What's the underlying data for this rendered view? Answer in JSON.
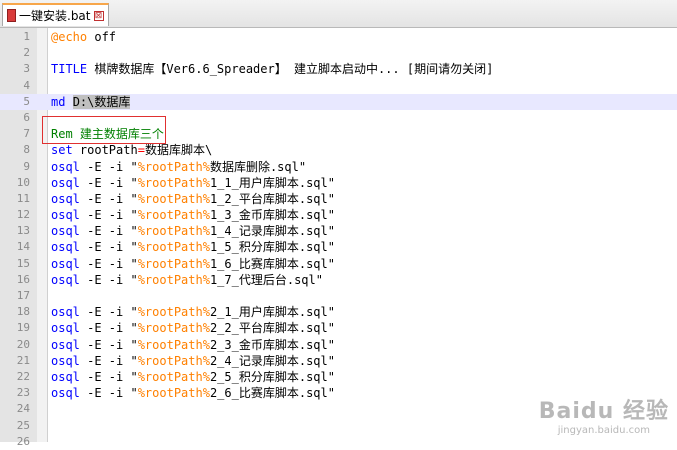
{
  "tab": {
    "title": "一键安装.bat",
    "close_glyph": "⊠"
  },
  "lines": [
    [
      {
        "t": "@echo",
        "c": "d"
      },
      {
        "t": " off",
        "c": "t"
      }
    ],
    [],
    [
      {
        "t": "TITLE",
        "c": "k"
      },
      {
        "t": " 棋牌数据库【Ver6.6_Spreader】 建立脚本启动中... ",
        "c": "t"
      },
      {
        "t": "[",
        "c": "t"
      },
      {
        "t": "期间请勿关闭",
        "c": "t"
      },
      {
        "t": "]",
        "c": "t"
      }
    ],
    [],
    [
      {
        "t": "md",
        "c": "k"
      },
      {
        "t": " ",
        "c": "t"
      },
      {
        "t": "D:\\数据库",
        "c": "sel"
      }
    ],
    [],
    [
      {
        "t": "Rem 建主数据库三个",
        "c": "c"
      }
    ],
    [
      {
        "t": "set",
        "c": "k"
      },
      {
        "t": " rootPath",
        "c": "t"
      },
      {
        "t": "=",
        "c": "e"
      },
      {
        "t": "数据库脚本\\",
        "c": "t"
      }
    ],
    [
      {
        "t": "osql",
        "c": "k"
      },
      {
        "t": " -E -i \"",
        "c": "t"
      },
      {
        "t": "%rootPath%",
        "c": "v"
      },
      {
        "t": "数据库删除.sql\"",
        "c": "t"
      }
    ],
    [
      {
        "t": "osql",
        "c": "k"
      },
      {
        "t": " -E -i \"",
        "c": "t"
      },
      {
        "t": "%rootPath%",
        "c": "v"
      },
      {
        "t": "1_1_用户库脚本.sql\"",
        "c": "t"
      }
    ],
    [
      {
        "t": "osql",
        "c": "k"
      },
      {
        "t": " -E -i \"",
        "c": "t"
      },
      {
        "t": "%rootPath%",
        "c": "v"
      },
      {
        "t": "1_2_平台库脚本.sql\"",
        "c": "t"
      }
    ],
    [
      {
        "t": "osql",
        "c": "k"
      },
      {
        "t": " -E -i \"",
        "c": "t"
      },
      {
        "t": "%rootPath%",
        "c": "v"
      },
      {
        "t": "1_3_金币库脚本.sql\"",
        "c": "t"
      }
    ],
    [
      {
        "t": "osql",
        "c": "k"
      },
      {
        "t": " -E -i \"",
        "c": "t"
      },
      {
        "t": "%rootPath%",
        "c": "v"
      },
      {
        "t": "1_4_记录库脚本.sql\"",
        "c": "t"
      }
    ],
    [
      {
        "t": "osql",
        "c": "k"
      },
      {
        "t": " -E -i \"",
        "c": "t"
      },
      {
        "t": "%rootPath%",
        "c": "v"
      },
      {
        "t": "1_5_积分库脚本.sql\"",
        "c": "t"
      }
    ],
    [
      {
        "t": "osql",
        "c": "k"
      },
      {
        "t": " -E -i \"",
        "c": "t"
      },
      {
        "t": "%rootPath%",
        "c": "v"
      },
      {
        "t": "1_6_比赛库脚本.sql\"",
        "c": "t"
      }
    ],
    [
      {
        "t": "osql",
        "c": "k"
      },
      {
        "t": " -E -i \"",
        "c": "t"
      },
      {
        "t": "%rootPath%",
        "c": "v"
      },
      {
        "t": "1_7_代理后台.sql\"",
        "c": "t"
      }
    ],
    [],
    [
      {
        "t": "osql",
        "c": "k"
      },
      {
        "t": " -E -i \"",
        "c": "t"
      },
      {
        "t": "%rootPath%",
        "c": "v"
      },
      {
        "t": "2_1_用户库脚本.sql\"",
        "c": "t"
      }
    ],
    [
      {
        "t": "osql",
        "c": "k"
      },
      {
        "t": " -E -i \"",
        "c": "t"
      },
      {
        "t": "%rootPath%",
        "c": "v"
      },
      {
        "t": "2_2_平台库脚本.sql\"",
        "c": "t"
      }
    ],
    [
      {
        "t": "osql",
        "c": "k"
      },
      {
        "t": " -E -i \"",
        "c": "t"
      },
      {
        "t": "%rootPath%",
        "c": "v"
      },
      {
        "t": "2_3_金币库脚本.sql\"",
        "c": "t"
      }
    ],
    [
      {
        "t": "osql",
        "c": "k"
      },
      {
        "t": " -E -i \"",
        "c": "t"
      },
      {
        "t": "%rootPath%",
        "c": "v"
      },
      {
        "t": "2_4_记录库脚本.sql\"",
        "c": "t"
      }
    ],
    [
      {
        "t": "osql",
        "c": "k"
      },
      {
        "t": " -E -i \"",
        "c": "t"
      },
      {
        "t": "%rootPath%",
        "c": "v"
      },
      {
        "t": "2_5_积分库脚本.sql\"",
        "c": "t"
      }
    ],
    [
      {
        "t": "osql",
        "c": "k"
      },
      {
        "t": " -E -i \"",
        "c": "t"
      },
      {
        "t": "%rootPath%",
        "c": "v"
      },
      {
        "t": "2_6_比赛库脚本.sql\"",
        "c": "t"
      }
    ],
    [],
    [],
    []
  ],
  "line_numbers": [
    "1",
    "2",
    "3",
    "4",
    "5",
    "6",
    "7",
    "8",
    "9",
    "10",
    "11",
    "12",
    "13",
    "14",
    "15",
    "16",
    "17",
    "18",
    "19",
    "20",
    "21",
    "22",
    "23",
    "24",
    "25",
    "26"
  ],
  "current_line": 5,
  "watermark": {
    "logo": "Baidu 经验",
    "url": "jingyan.baidu.com"
  },
  "colors": {
    "keyword": "#0000ff",
    "variable": "#ff8000",
    "comment": "#008000",
    "current_line_bg": "#e8e8ff",
    "highlight_box": "#e03030"
  }
}
